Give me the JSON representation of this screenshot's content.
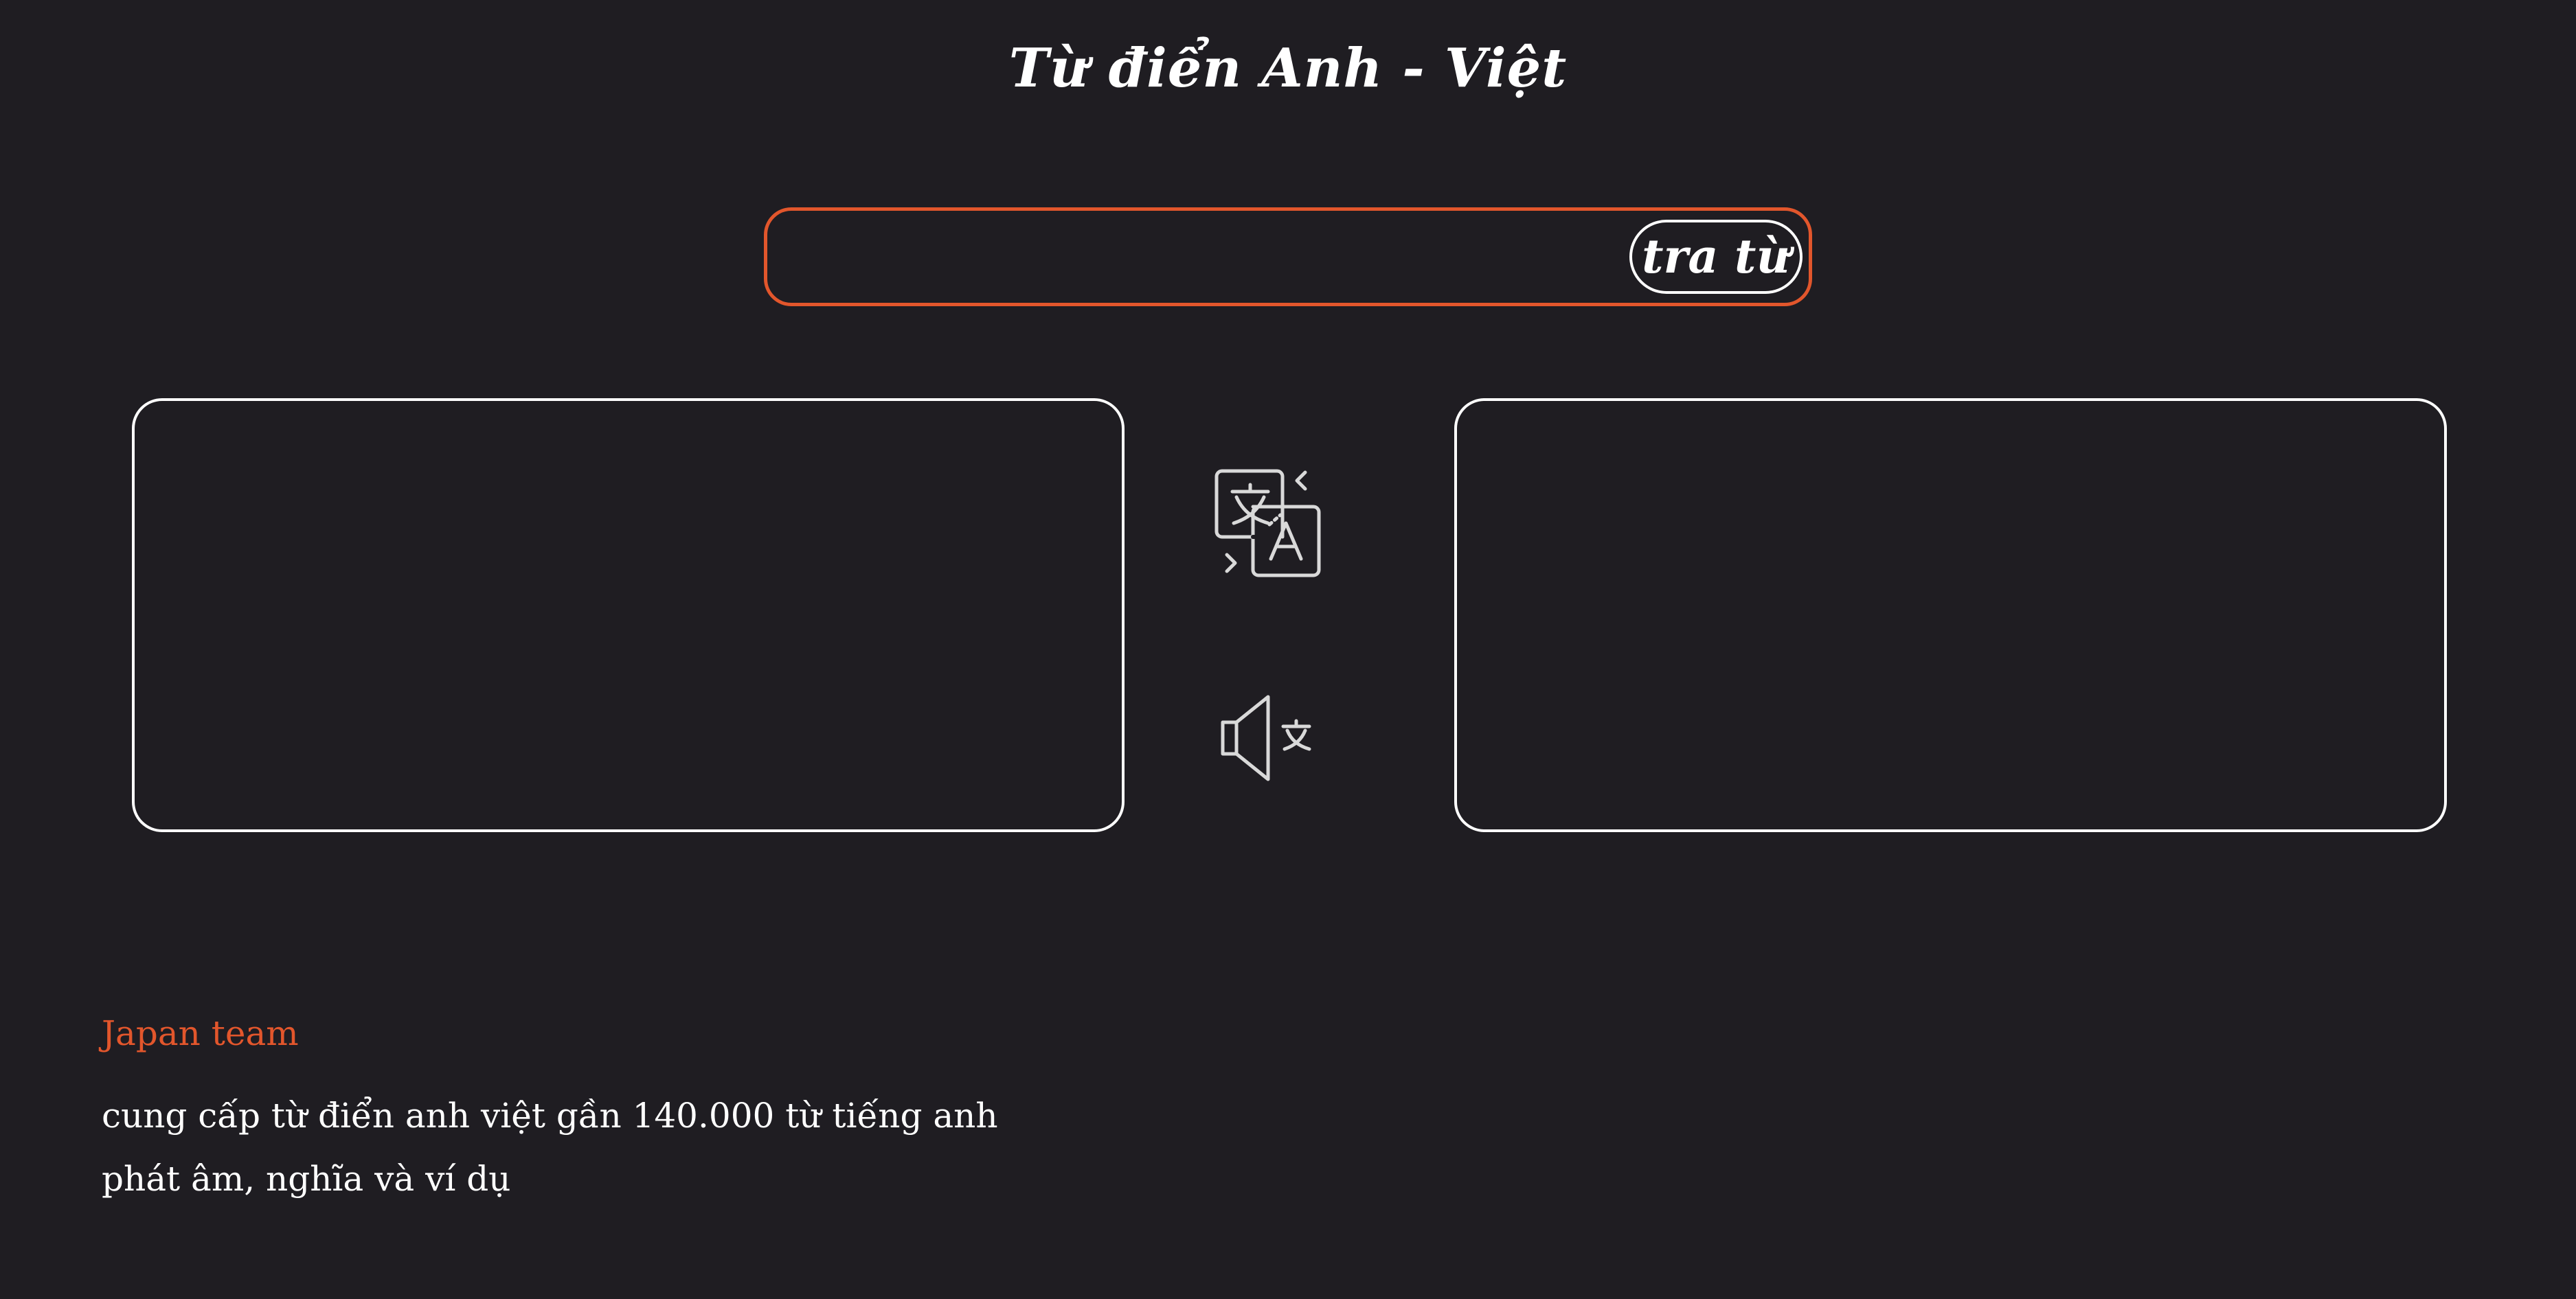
{
  "header": {
    "title": "Từ điển Anh - Việt"
  },
  "search": {
    "value": "",
    "placeholder": "",
    "button_label": "tra từ"
  },
  "icons": {
    "translate": "translate-icon",
    "speaker": "speaker-translate-icon"
  },
  "colors": {
    "background": "#1f1d22",
    "accent": "#e2562c",
    "foreground": "#ffffff",
    "icon": "#d9d9d9"
  },
  "footer": {
    "brand": "Japan team",
    "line1": "cung cấp từ điển anh việt gần 140.000 từ tiếng anh",
    "line2": "phát âm, nghĩa và ví dụ"
  }
}
